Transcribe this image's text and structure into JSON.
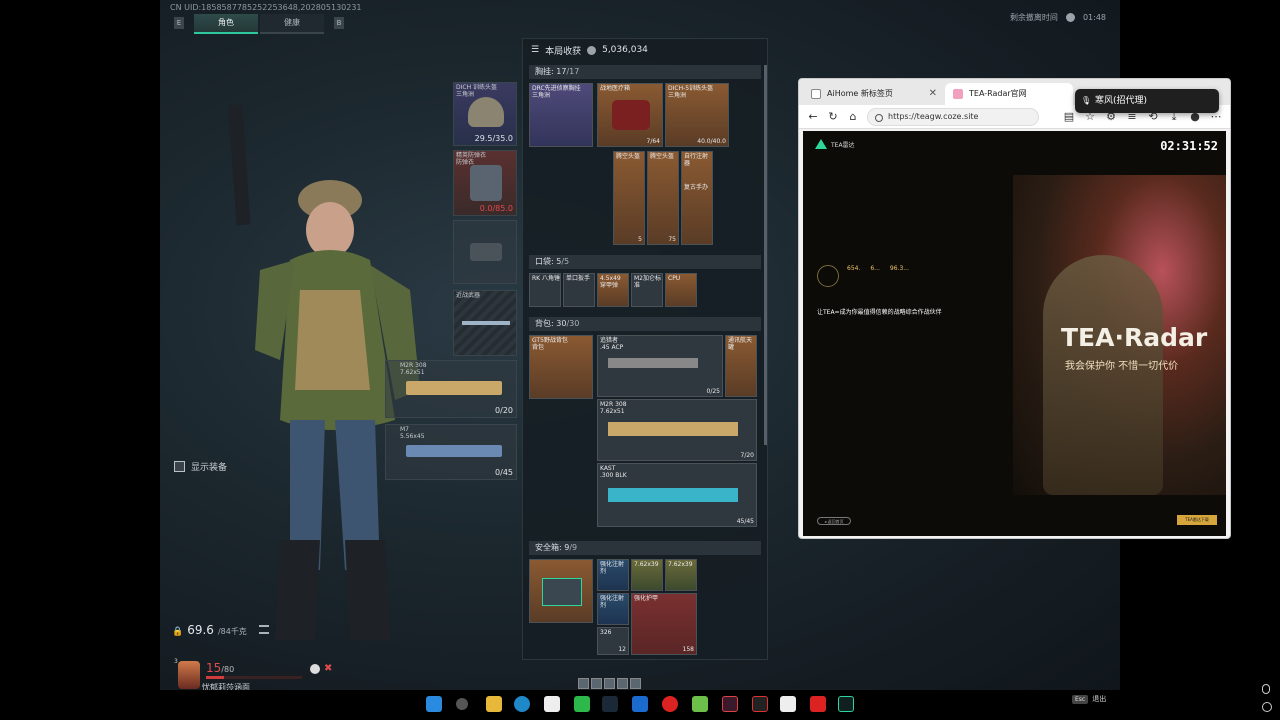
{
  "header": {
    "uid": "CN UID:1858587785252253648,202805130231",
    "tab_left_key": "E",
    "tab_right_key": "B",
    "tabs": [
      {
        "label": "角色"
      },
      {
        "label": "健康"
      }
    ],
    "time_label": "剩余撤离时间",
    "time_value": "01:48"
  },
  "left": {
    "show_equipment_label": "显示装备",
    "weight_value": "69.6",
    "weight_max": "/84千克",
    "player": {
      "level": "3",
      "hp": "15",
      "hp_max": "/80",
      "name": "忧郁莉莎涵面",
      "hp_fraction": 0.19
    }
  },
  "equipment_slots": {
    "helmet": {
      "label": "DICH 训练头盔\n三角洲",
      "value": "29.5/35.0"
    },
    "armor": {
      "label": "精英防弹衣\n防弹衣",
      "value": "0.0/85.0"
    },
    "pistol": {
      "label": ""
    },
    "melee": {
      "label": "近战武器"
    },
    "weapon1": {
      "label": "M2R 308\n7.62x51",
      "value": "0/20"
    },
    "weapon2": {
      "label": "M7\n5.56x45",
      "value": "0/45"
    }
  },
  "loot_panel": {
    "title": "本局收获",
    "total": "5,036,034",
    "sections": {
      "chest": {
        "label": "胸挂:",
        "count": "17",
        "max": "/17"
      },
      "pocket": {
        "label": "口袋:",
        "count": "5",
        "max": "/5"
      },
      "backpack": {
        "label": "背包:",
        "count": "30",
        "max": "/30"
      },
      "safebox": {
        "label": "安全箱:",
        "count": "9",
        "max": "/9"
      }
    },
    "items": {
      "rig": {
        "label": "DRC先进侦察胸挂\n三角洲"
      },
      "medkit": {
        "label": "战地医疗箱",
        "value": "7/64"
      },
      "helmet2": {
        "label": "DICH-5训练头盔\n三角洲",
        "value": "40.0/40.0"
      },
      "shotgun_shell1": {
        "label": "腾空头盔",
        "value": "5"
      },
      "shotgun_shell2": {
        "label": "腾空头盔",
        "value": "75"
      },
      "injector": {
        "label": "自行注射器"
      },
      "figurine": {
        "label": "复古手办"
      },
      "p1": {
        "label": "RK 八角锤"
      },
      "p2": {
        "label": "单口扳手"
      },
      "p3": {
        "label": "4.5x49\n穿甲弹"
      },
      "p4": {
        "label": "M2加仑标准"
      },
      "p5": {
        "label": "CPU"
      },
      "bag": {
        "label": "GT5野战背包\n背包"
      },
      "gun1": {
        "label": "追猎者\n.45 ACP",
        "value": "0/25"
      },
      "gun1b": {
        "label": "通讯航天罐"
      },
      "gun2": {
        "label": "M2R 308\n7.62x51",
        "value": "7/20"
      },
      "gun3": {
        "label": "KAST\n.300 BLK",
        "value": "45/45"
      },
      "safe_case": {
        "label": ""
      },
      "s1": {
        "label": "强化注射剂"
      },
      "s2": {
        "label": "7.62x39"
      },
      "s3": {
        "label": "7.62x39"
      },
      "s4": {
        "label": "强化注射剂"
      },
      "s5": {
        "label": "强化护甲"
      },
      "s6": {
        "label": "326",
        "value": "12"
      },
      "s7": {
        "label": "",
        "value": "158"
      }
    }
  },
  "browser": {
    "tabs": [
      {
        "title": "AiHome 新标签页",
        "close": "✕"
      },
      {
        "title": "TEA-Radar官网",
        "close": "✕"
      }
    ],
    "url": "https://teagw.coze.site",
    "tooltip": "寒风(招代理)",
    "site": {
      "logo_text": "TEA雷达",
      "time": "02:31:52",
      "title": "TEA·Radar",
      "subtitle": "我会保护你 不惜一切代价",
      "stats": [
        "654.",
        "6...",
        "96.3..."
      ],
      "promo_title": "让TEA=成为你最值得信赖的战略综合作战伙伴",
      "cta": "TEA雷达下载",
      "back": "◂ 返回首页"
    }
  },
  "taskbar": {
    "lang_key": "Esc",
    "lang_label": "退出"
  },
  "colors": {
    "accent": "#2ec8a0",
    "danger": "#d23c3c",
    "gold": "#d6a53c"
  }
}
